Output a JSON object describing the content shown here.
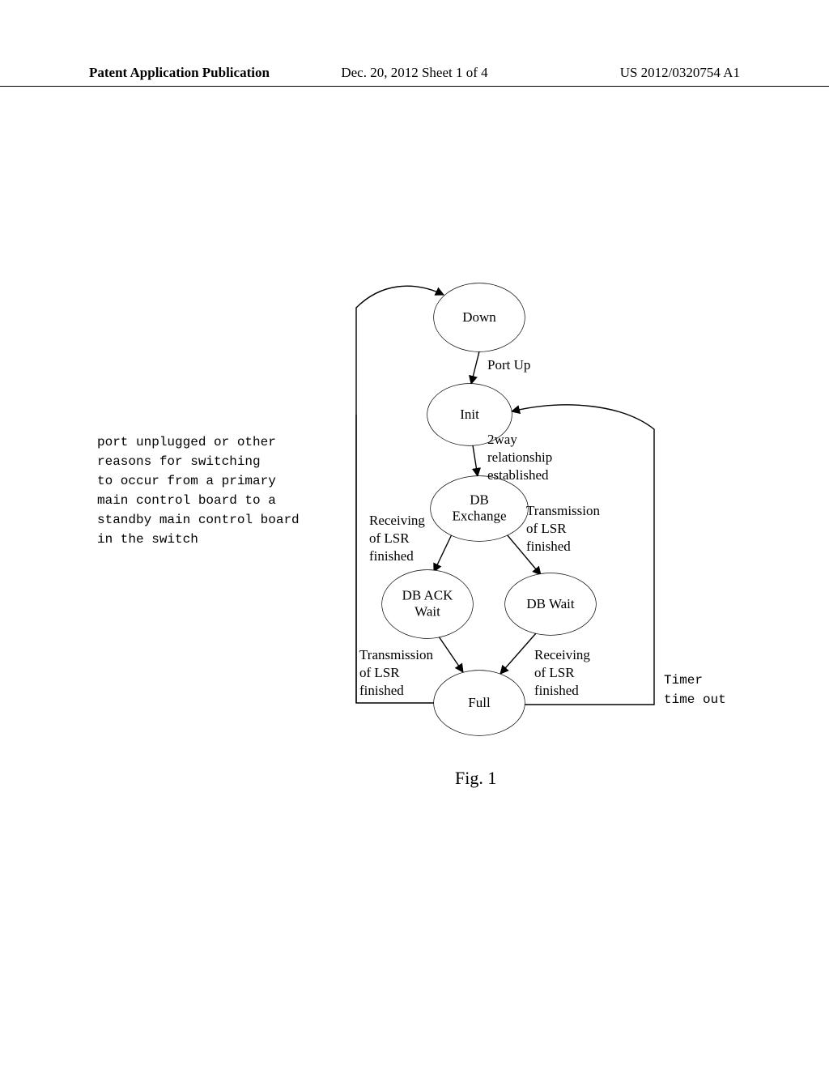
{
  "header": {
    "left": "Patent Application Publication",
    "center": "Dec. 20, 2012  Sheet 1 of 4",
    "right": "US 2012/0320754 A1"
  },
  "states": {
    "down": "Down",
    "init": "Init",
    "db_exchange": "DB\nExchange",
    "db_ack_wait": "DB ACK\nWait",
    "db_wait": "DB Wait",
    "full": "Full"
  },
  "transitions": {
    "port_up": "Port Up",
    "twoway": "2way\nrelationship\nestablished",
    "rx_lsr_fin_left": "Receiving\nof LSR\nfinished",
    "tx_lsr_fin_right": "Transmission\nof LSR\nfinished",
    "tx_lsr_fin_left": "Transmission\nof LSR\nfinished",
    "rx_lsr_fin_right": "Receiving\nof LSR\nfinished",
    "timer": "Timer\ntime out",
    "unplugged": "port unplugged or other\nreasons for switching\nto occur from a primary\nmain control board to a\nstandby main control board\nin the switch"
  },
  "figure_caption": "Fig. 1",
  "chart_data": {
    "type": "state-diagram",
    "title": "Fig. 1",
    "nodes": [
      {
        "id": "down",
        "label": "Down"
      },
      {
        "id": "init",
        "label": "Init"
      },
      {
        "id": "db_exchange",
        "label": "DB Exchange"
      },
      {
        "id": "db_ack_wait",
        "label": "DB ACK Wait"
      },
      {
        "id": "db_wait",
        "label": "DB Wait"
      },
      {
        "id": "full",
        "label": "Full"
      }
    ],
    "edges": [
      {
        "from": "down",
        "to": "init",
        "label": "Port Up"
      },
      {
        "from": "init",
        "to": "db_exchange",
        "label": "2way relationship established"
      },
      {
        "from": "db_exchange",
        "to": "db_ack_wait",
        "label": "Receiving of LSR finished"
      },
      {
        "from": "db_exchange",
        "to": "db_wait",
        "label": "Transmission of LSR finished"
      },
      {
        "from": "db_ack_wait",
        "to": "full",
        "label": "Transmission of LSR finished"
      },
      {
        "from": "db_wait",
        "to": "full",
        "label": "Receiving of LSR finished"
      },
      {
        "from": "full",
        "to": "init",
        "label": "Timer time out"
      },
      {
        "from": "full",
        "to": "down",
        "label": "port unplugged or other reasons for switching to occur from a primary main control board to a standby main control board in the switch"
      }
    ]
  }
}
